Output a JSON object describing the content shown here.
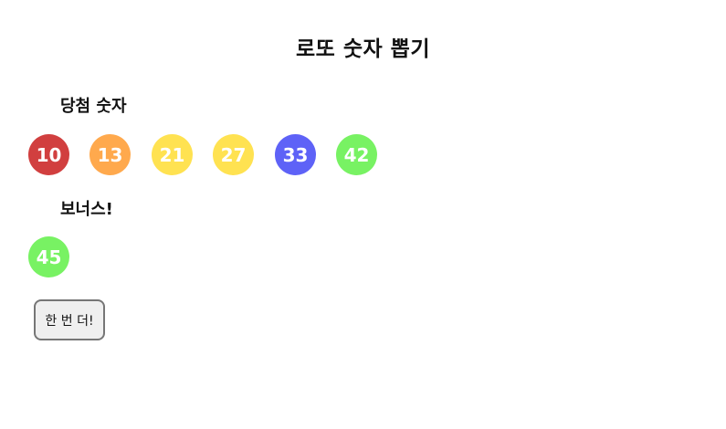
{
  "title": "로또 숫자 뽑기",
  "winning": {
    "label": "당첨 숫자",
    "balls": [
      {
        "number": "10",
        "color": "#d13f3f"
      },
      {
        "number": "13",
        "color": "#ffa94d"
      },
      {
        "number": "21",
        "color": "#ffe251"
      },
      {
        "number": "27",
        "color": "#ffe251"
      },
      {
        "number": "33",
        "color": "#5e62f7"
      },
      {
        "number": "42",
        "color": "#78f263"
      }
    ]
  },
  "bonus": {
    "label": "보너스!",
    "ball": {
      "number": "45",
      "color": "#78f263"
    }
  },
  "retry_button": {
    "label": "한 번 더!"
  }
}
